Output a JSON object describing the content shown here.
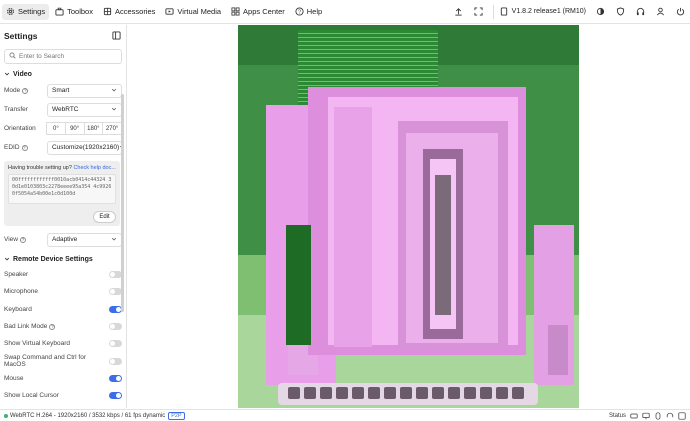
{
  "topbar": {
    "tabs": [
      {
        "label": "Settings",
        "icon": "gear-icon",
        "active": true
      },
      {
        "label": "Toolbox",
        "icon": "toolbox-icon"
      },
      {
        "label": "Accessories",
        "icon": "accessories-icon"
      },
      {
        "label": "Virtual Media",
        "icon": "media-icon"
      },
      {
        "label": "Apps Center",
        "icon": "apps-icon"
      },
      {
        "label": "Help",
        "icon": "help-icon"
      }
    ],
    "version": "V1.8.2 release1 (RM10)"
  },
  "sidebar": {
    "title": "Settings",
    "search_placeholder": "Enter to Search",
    "video": {
      "title": "Video",
      "mode_label": "Mode",
      "mode_value": "Smart",
      "transfer_label": "Transfer",
      "transfer_value": "WebRTC",
      "orientation_label": "Orientation",
      "orientation_options": [
        "0°",
        "90°",
        "180°",
        "270°"
      ],
      "edid_label": "EDID",
      "edid_value": "Customize(1920x2160)",
      "help_text": "Having trouble setting up?",
      "help_link": "Check help doc...",
      "edid_hex": "00ffffffffffff0010acb0414c44324 30d1e0103803c2278eeee95a354 4c99260f5054a54b00e1c0d100d",
      "edit_label": "Edit",
      "view_label": "View",
      "view_value": "Adaptive"
    },
    "remote": {
      "title": "Remote Device Settings",
      "items": [
        {
          "label": "Speaker",
          "on": false,
          "help": false
        },
        {
          "label": "Microphone",
          "on": false,
          "help": false
        },
        {
          "label": "Keyboard",
          "on": true,
          "help": false
        },
        {
          "label": "Bad Link Mode",
          "on": false,
          "help": true
        },
        {
          "label": "Show Virtual Keyboard",
          "on": false,
          "help": false
        },
        {
          "label": "Swap Command and Ctrl for MacOS",
          "on": false,
          "help": false
        },
        {
          "label": "Mouse",
          "on": true,
          "help": false
        },
        {
          "label": "Show Local Cursor",
          "on": true,
          "help": false
        }
      ]
    }
  },
  "statusbar": {
    "info": "WebRTC H.264 - 1920x2160 / 3532 kbps / 61 fps dynamic",
    "p2p": "P2P",
    "status_label": "Status"
  },
  "colors": {
    "accent": "#3d6ee8",
    "screen_green": "#5aa95a",
    "screen_pink": "#f0a8f0"
  }
}
